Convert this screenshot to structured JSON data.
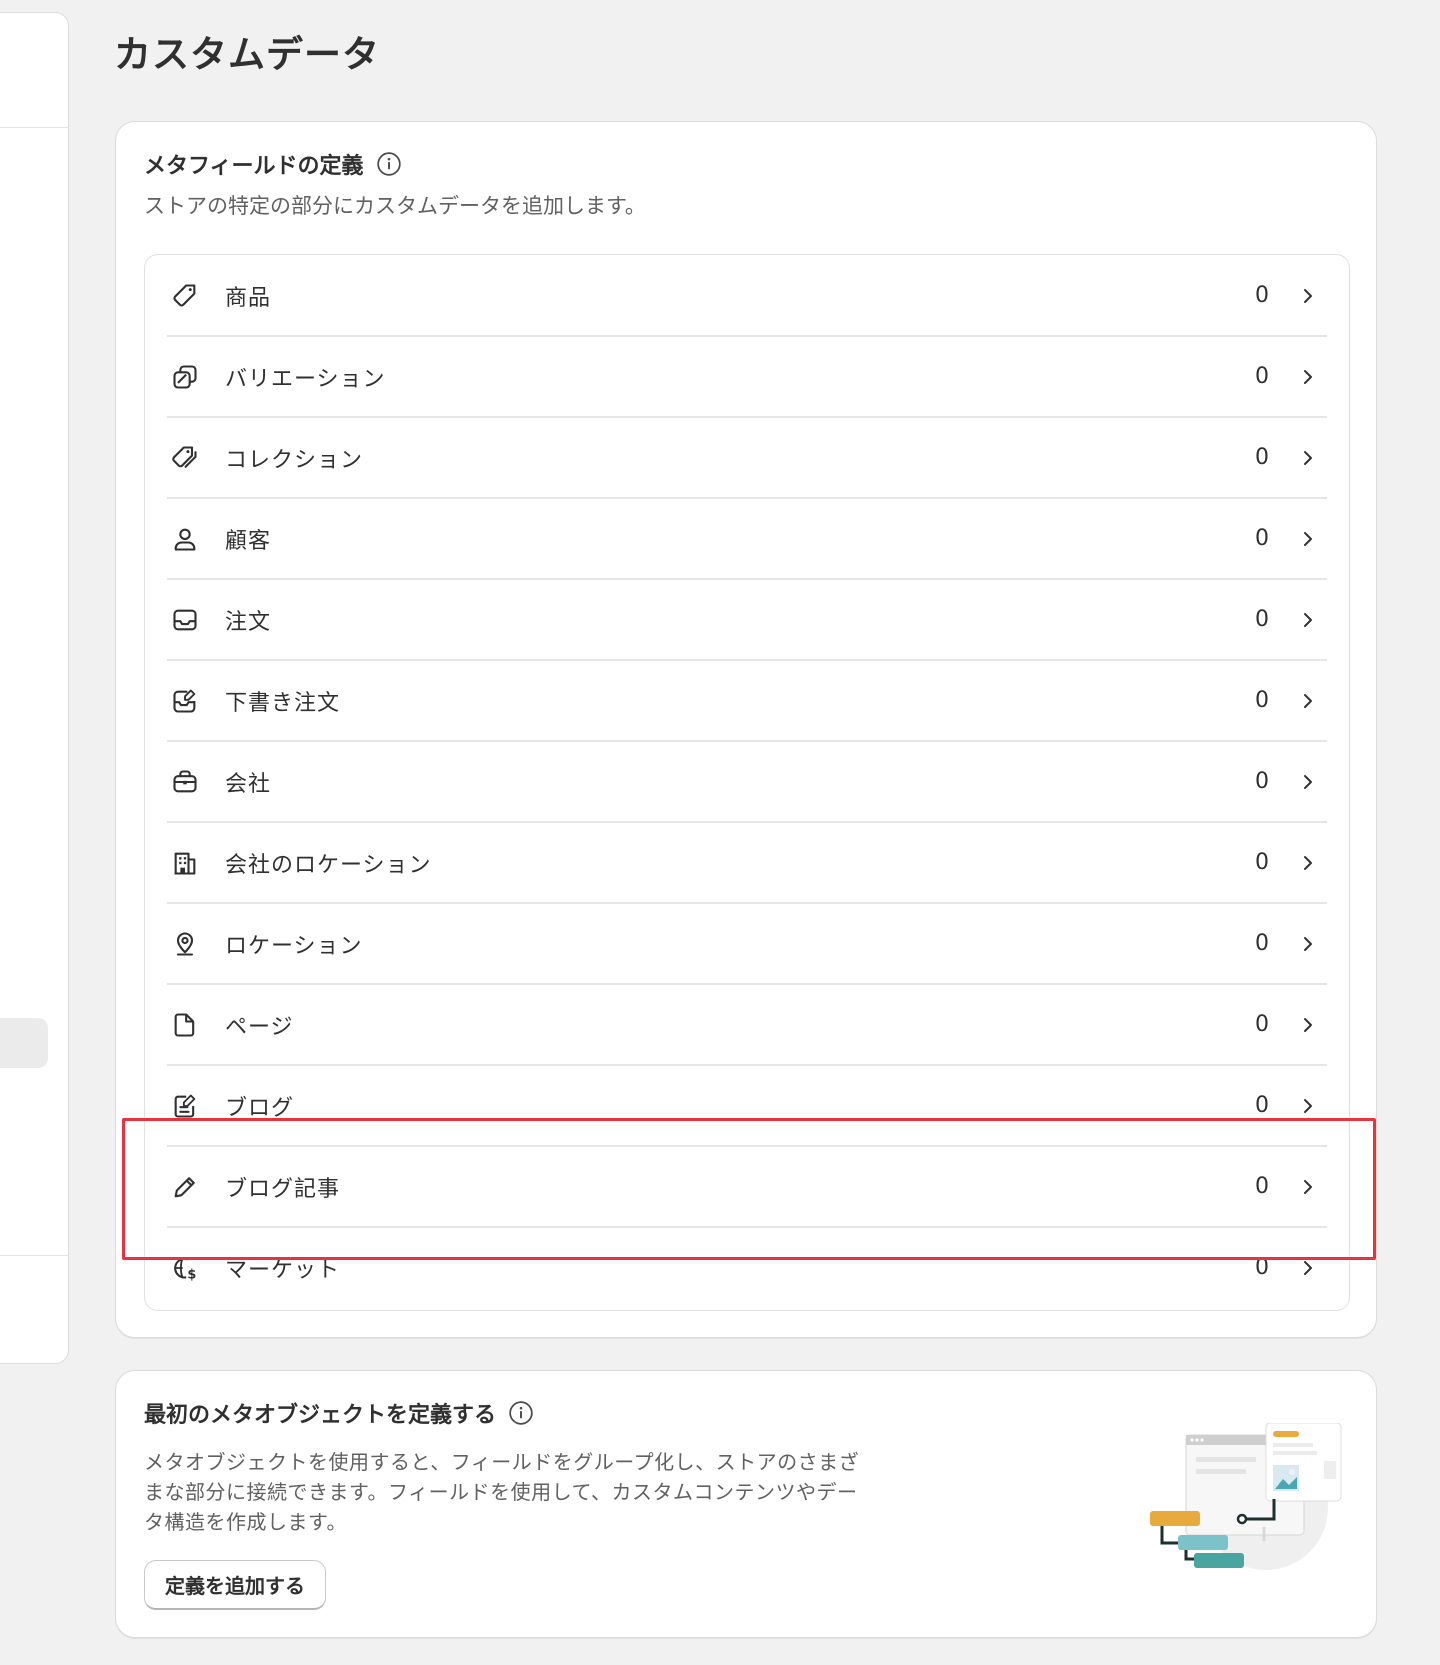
{
  "page": {
    "title": "カスタムデータ"
  },
  "metafields": {
    "title": "メタフィールドの定義",
    "subtitle": "ストアの特定の部分にカスタムデータを追加します。",
    "items": [
      {
        "label": "商品",
        "count": "0",
        "icon": "tag-icon"
      },
      {
        "label": "バリエーション",
        "count": "0",
        "icon": "variant-icon"
      },
      {
        "label": "コレクション",
        "count": "0",
        "icon": "collection-tags-icon"
      },
      {
        "label": "顧客",
        "count": "0",
        "icon": "person-icon"
      },
      {
        "label": "注文",
        "count": "0",
        "icon": "inbox-icon"
      },
      {
        "label": "下書き注文",
        "count": "0",
        "icon": "draft-order-icon"
      },
      {
        "label": "会社",
        "count": "0",
        "icon": "briefcase-icon"
      },
      {
        "label": "会社のロケーション",
        "count": "0",
        "icon": "building-icon"
      },
      {
        "label": "ロケーション",
        "count": "0",
        "icon": "location-pin-icon"
      },
      {
        "label": "ページ",
        "count": "0",
        "icon": "page-icon"
      },
      {
        "label": "ブログ",
        "count": "0",
        "icon": "blog-icon"
      },
      {
        "label": "ブログ記事",
        "count": "0",
        "icon": "pencil-icon"
      },
      {
        "label": "マーケット",
        "count": "0",
        "icon": "globe-dollar-icon"
      }
    ]
  },
  "metaobjects": {
    "title": "最初のメタオブジェクトを定義する",
    "description": "メタオブジェクトを使用すると、フィールドをグループ化し、ストアのさまざまな部分に接続できます。フィールドを使用して、カスタムコンテンツやデータ構造を作成します。",
    "add_button": "定義を追加する"
  },
  "colors": {
    "highlight": "#e8323f",
    "background": "#f1f1f1",
    "card": "#ffffff",
    "text": "#303030",
    "muted_text": "#616161"
  }
}
